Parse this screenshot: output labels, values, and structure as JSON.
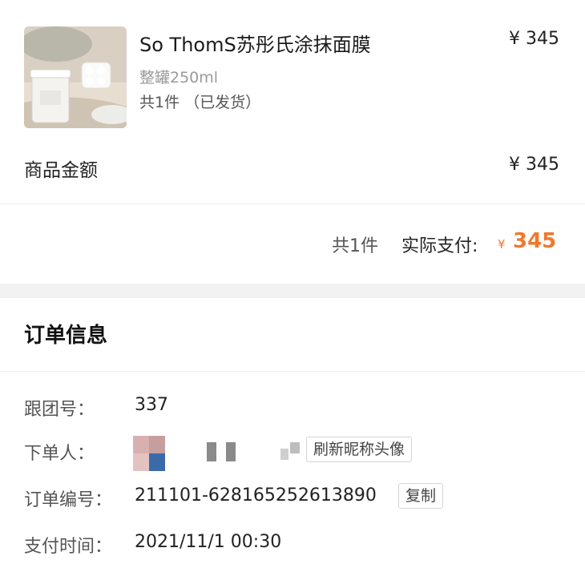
{
  "product": {
    "name": "So ThomS苏彤氏涂抹面膜",
    "spec": "整罐250ml",
    "quantity_status": "共1件 （已发货）",
    "price": "¥ 345",
    "image_icon": "product-photo"
  },
  "totals": {
    "goods_amount_label": "商品金额",
    "goods_amount_value": "¥ 345",
    "item_count": "共1件",
    "actual_paid_label": "实际支付:",
    "currency_symbol": "¥",
    "actual_paid_amount": "345",
    "accent_color": "#ee7a2e"
  },
  "order_info": {
    "title": "订单信息",
    "group_label": "跟团号：",
    "group_value": "337",
    "buyer_label": "下单人：",
    "buyer_button_label": "刷新昵称头像",
    "order_no_label": "订单编号：",
    "order_no_value": "211101-628165252613890",
    "copy_button_label": "复制",
    "pay_time_label": "支付时间：",
    "pay_time_value": "2021/11/1 00:30"
  }
}
